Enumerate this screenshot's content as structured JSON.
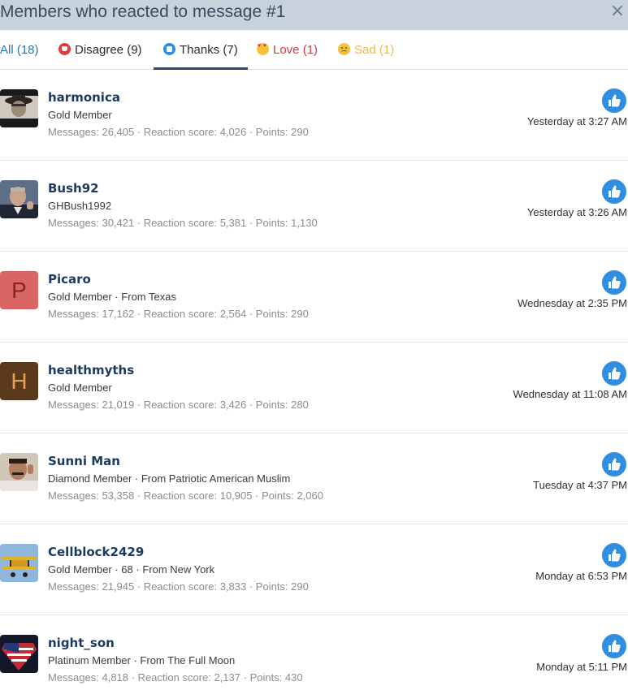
{
  "dialog": {
    "title": "Members who reacted to message #1",
    "close_icon": "×"
  },
  "tabs": {
    "all": "All (18)",
    "disagree": "Disagree (9)",
    "thanks": "Thanks (7)",
    "love": "Love (1)",
    "sad": "Sad (1)"
  },
  "colors": {
    "header_bg": "#c8d2dd",
    "link_blue": "#2577b1",
    "love_red": "#d83a37",
    "sad_yellow": "#f0b93a",
    "thanks_blue": "#2f8ee0",
    "username": "#1c3a5e"
  },
  "members": [
    {
      "username": "harmonica",
      "title": "Gold Member",
      "stats": "Messages: 26,405 · Reaction score: 4,026 · Points: 290",
      "time": "Yesterday at 3:27 AM",
      "avatar": "photo-cowboy"
    },
    {
      "username": "Bush92",
      "title": "GHBush1992",
      "stats": "Messages: 30,421 · Reaction score: 5,381 · Points: 1,130",
      "time": "Yesterday at 3:26 AM",
      "avatar": "photo-portrait"
    },
    {
      "username": "Picaro",
      "title": "Gold Member · From Texas",
      "stats": "Messages: 17,162 · Reaction score: 2,564 · Points: 290",
      "time": "Wednesday at 2:35 PM",
      "avatar_letter": "P",
      "avatar_bg": "#d96565",
      "avatar_fg": "#8a2222"
    },
    {
      "username": "healthmyths",
      "title": "Gold Member",
      "stats": "Messages: 21,019 · Reaction score: 3,426 · Points: 280",
      "time": "Wednesday at 11:08 AM",
      "avatar_letter": "H",
      "avatar_bg": "#5a3a1a",
      "avatar_fg": "#e0a35a"
    },
    {
      "username": "Sunni Man",
      "title": "Diamond Member · From Patriotic American Muslim",
      "stats": "Messages: 53,358 · Reaction score: 10,905 · Points: 2,060",
      "time": "Tuesday at 4:37 PM",
      "avatar": "photo-man"
    },
    {
      "username": "Cellblock2429",
      "title": "Gold Member · 68 · From New York",
      "stats": "Messages: 21,945 · Reaction score: 3,833 · Points: 290",
      "time": "Monday at 6:53 PM",
      "avatar": "photo-biplane"
    },
    {
      "username": "night_son",
      "title": "Platinum Member · From The Full Moon",
      "stats": "Messages: 4,818 · Reaction score: 2,137 · Points: 430",
      "time": "Monday at 5:11 PM",
      "avatar": "flag-emblem"
    }
  ]
}
